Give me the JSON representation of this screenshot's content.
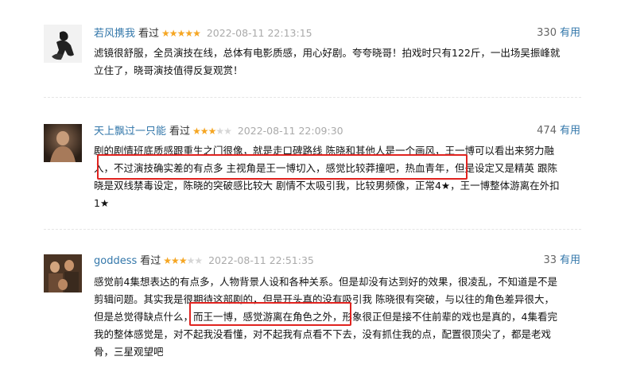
{
  "reviews": [
    {
      "username": "若风携我",
      "action": "看过",
      "rating": 5,
      "timestamp": "2022-08-11 22:13:15",
      "votes": "330",
      "useful_label": "有用",
      "lines": [
        "滤镜很舒服，全员演技在线，总体有电影质感，用心好剧。夸夸晓哥！拍戏时只有122斤，一出场吴振峰就",
        "立住了，晓哥演技值得反复观赏！"
      ]
    },
    {
      "username": "天上飘过一只能",
      "action": "看过",
      "rating": 3,
      "timestamp": "2022-08-11 22:09:30",
      "votes": "474",
      "useful_label": "有用",
      "lines": [
        "剧的剧情班底质感跟重生之门很像，就是走口碑路线 陈晓和其他人是一个画风，王一博可以看出来努力融",
        "入，不过演技确实差的有点多 主视角是王一博切入，感觉比较莽撞吧，热血青年，但是设定又是精英 跟陈",
        "晓是双线禁毒设定，陈晓的突破感比较大 剧情不太吸引我，比较男频像，正常4★，王一博整体游离在外扣",
        "1★"
      ]
    },
    {
      "username": "goddess",
      "action": "看过",
      "rating": 3,
      "timestamp": "2022-08-11 22:51:35",
      "votes": "33",
      "useful_label": "有用",
      "lines": [
        "感觉前4集想表达的有点多，人物背景人设和各种关系。但是却没有达到好的效果，很凌乱，不知道是不是",
        "剪辑问题。其实我是很期待这部剧的，但是开头真的没有吸引我 陈晓很有突破，与以往的角色差异很大，",
        "但是总觉得缺点什么，而王一博，感觉游离在角色之外，形象很正但是接不住前辈的戏也是真的，4集看完",
        "我的整体感觉是，对不起我没看懂，对不起我有点看不下去，没有抓住我的点，配置很顶尖了，都是老戏",
        "骨，三星观望吧"
      ]
    }
  ],
  "colors": {
    "link": "#3377aa",
    "star": "#f5a623",
    "star_empty": "#d6d6d6",
    "timestamp": "#aaaaaa",
    "highlight_box": "#e0231f"
  },
  "icons": {
    "rating": "star-icon",
    "avatar": "user-avatar-photo"
  }
}
